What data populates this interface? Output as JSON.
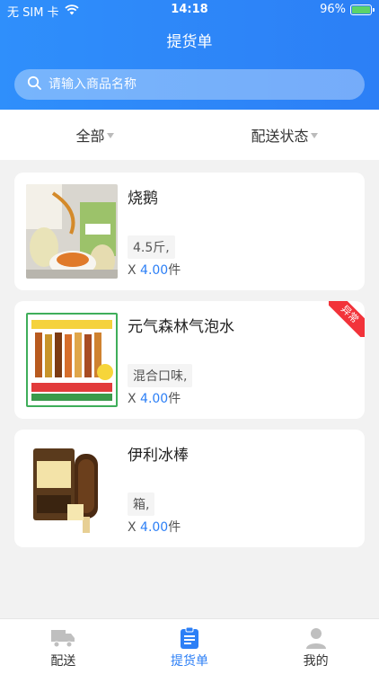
{
  "status_bar": {
    "carrier": "无 SIM 卡",
    "time": "14:18",
    "battery": "96%"
  },
  "header": {
    "title": "提货单"
  },
  "search": {
    "placeholder": "请输入商品名称"
  },
  "filters": [
    {
      "label": "全部"
    },
    {
      "label": "配送状态"
    }
  ],
  "orders": [
    {
      "name": "烧鹅",
      "spec": "4.5斤,",
      "qty_prefix": "X ",
      "qty_value": "4.00",
      "qty_unit": "件",
      "badge": ""
    },
    {
      "name": "元气森林气泡水",
      "spec": "混合口味,",
      "qty_prefix": "X ",
      "qty_value": "4.00",
      "qty_unit": "件",
      "badge": "异常"
    },
    {
      "name": "伊利冰棒",
      "spec": "箱,",
      "qty_prefix": "X ",
      "qty_value": "4.00",
      "qty_unit": "件",
      "badge": ""
    }
  ],
  "tabs": [
    {
      "label": "配送",
      "icon": "truck-icon"
    },
    {
      "label": "提货单",
      "icon": "clipboard-icon"
    },
    {
      "label": "我的",
      "icon": "user-icon"
    }
  ],
  "colors": {
    "brand": "#2c7ff6",
    "badge": "#f2333a",
    "battery_fill": "#5bd36a"
  }
}
